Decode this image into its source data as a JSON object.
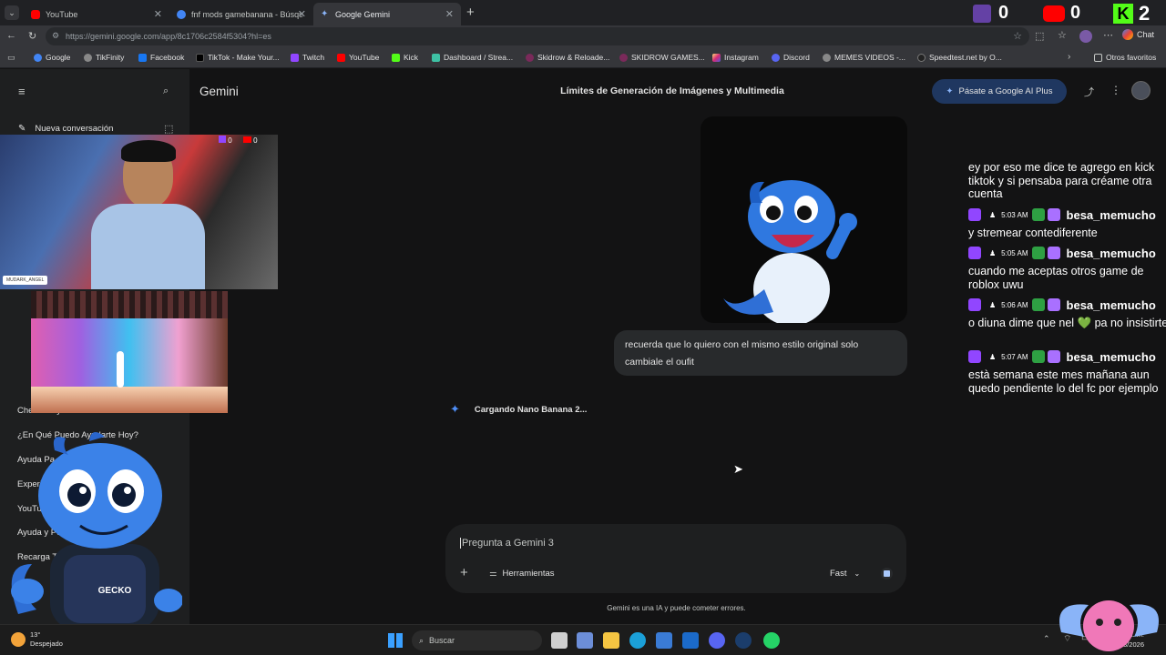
{
  "browser": {
    "tabs": [
      {
        "title": "YouTube",
        "active": false
      },
      {
        "title": "fnf mods gamebanana - Búsqueda",
        "active": false
      },
      {
        "title": "Google Gemini",
        "active": true
      }
    ],
    "url": "https://gemini.google.com/app/8c1706c2584f5304?hl=es",
    "chat_button": "Chat",
    "bookmarks": [
      "Google",
      "TikFinity",
      "Facebook",
      "TikTok - Make Your...",
      "Twitch",
      "YouTube",
      "Kick",
      "Dashboard / Strea...",
      "Skidrow & Reloade...",
      "SKIDROW GAMES...",
      "Instagram",
      "Discord",
      "MEMES VIDEOS -...",
      "Speedtest.net by O..."
    ],
    "other_bookmarks": "Otros favoritos"
  },
  "stream_counters": {
    "twitch": "0",
    "youtube": "0",
    "kick": "2"
  },
  "gemini": {
    "brand": "Gemini",
    "conversation_title": "Límites de Generación de Imágenes y Multimedia",
    "upgrade_button": "Pásate a Google AI Plus",
    "new_chat": "Nueva conversación",
    "sidebar_items": [
      "Chevrolet y Comentas en YouTube",
      "¿En Qué Puedo Ayudarte Hoy?",
      "Ayuda Pa...",
      "Experien...",
      "YouTube ... ...ies",
      "Ayuda y Posib... ...i",
      "Recarga Tar..."
    ],
    "user_message": "recuerda que lo quiero con el mismo estilo original solo cambiale el oufit",
    "loading_text": "Cargando Nano Banana 2...",
    "input_placeholder": "Pregunta a Gemini 3",
    "tools_label": "Herramientas",
    "mode_label": "Fast",
    "disclaimer": "Gemini es una IA y puede cometer errores."
  },
  "chat_overlay": {
    "first_message": "ey por eso me dice te agrego en kick tiktok y si pensaba para créame otra cuenta",
    "messages": [
      {
        "time": "5:03 AM",
        "user": "besa_memucho",
        "text": "y stremear contediferente"
      },
      {
        "time": "5:05 AM",
        "user": "besa_memucho",
        "text": "cuando me aceptas otros game de roblox uwu"
      },
      {
        "time": "5:06 AM",
        "user": "besa_memucho",
        "text": "o diuna dime que nel 💚 pa no insistirte"
      },
      {
        "time": "5:07 AM",
        "user": "besa_memucho",
        "text": "està semana este mes mañana aun quedo pendiente lo del fc por ejemplo"
      }
    ]
  },
  "webcam": {
    "name_tag": "MUDARK_ANGEL",
    "mini_counts": [
      "0",
      "0"
    ]
  },
  "mascot": {
    "jersey_text": "GECKO"
  },
  "taskbar": {
    "weather_temp": "13°",
    "weather_desc": "Despejado",
    "search_label": "Buscar",
    "time": "5:18 a. m.",
    "date": "16/03/2026"
  }
}
